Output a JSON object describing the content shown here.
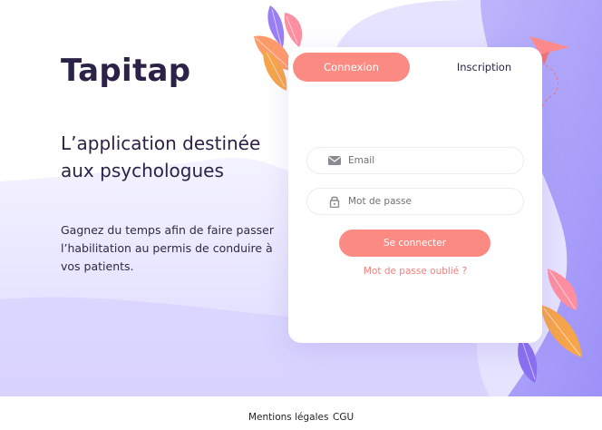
{
  "brand": {
    "name": "Tapitap"
  },
  "hero": {
    "headline": "L’application destinée aux psychologues",
    "subtext": "Gagnez du temps afin de faire passer l’habilitation au permis de conduire à vos patients."
  },
  "card": {
    "tabs": [
      {
        "label": "Connexion",
        "active": true
      },
      {
        "label": "Inscription",
        "active": false
      }
    ],
    "email": {
      "placeholder": "Email",
      "value": "",
      "icon": "envelope-icon"
    },
    "password": {
      "placeholder": "Mot de passe",
      "value": "",
      "icon": "lock-icon"
    },
    "submit_label": "Se connecter",
    "forgot_label": "Mot de passe oublié ?"
  },
  "footer": {
    "links": [
      {
        "label": "Mentions légales"
      },
      {
        "label": "CGU"
      }
    ]
  },
  "colors": {
    "accent": "#fb8a83",
    "text_dark": "#2a2347",
    "purple": "#a79cf9",
    "lavender_light": "#ebe9ff"
  }
}
